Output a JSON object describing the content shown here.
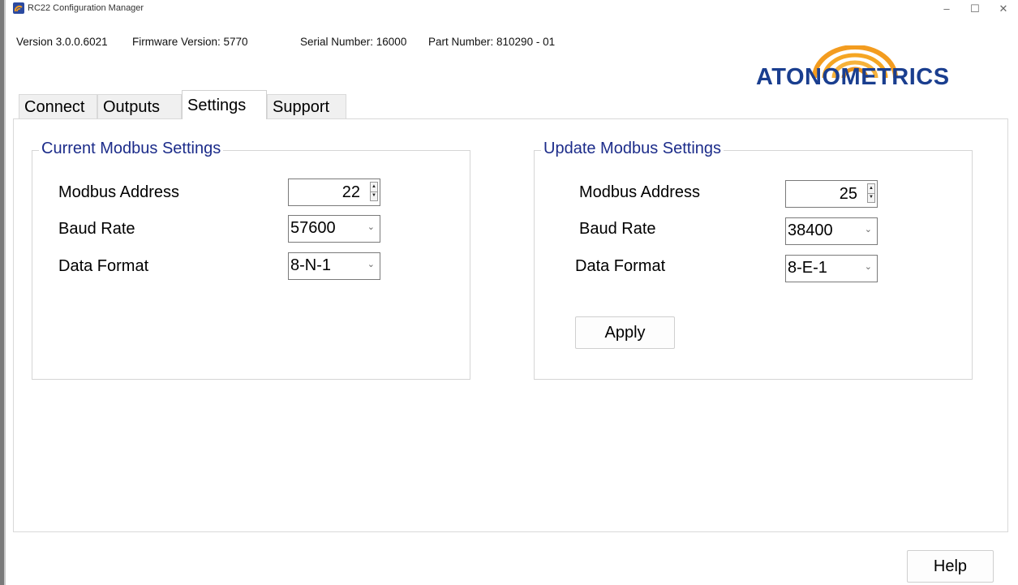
{
  "window": {
    "title": "RC22 Configuration Manager",
    "controls": {
      "minimize": "–",
      "maximize": "☐",
      "close": "✕"
    }
  },
  "info": {
    "version": "Version 3.0.0.6021",
    "firmware": "Firmware Version: 5770",
    "serial": "Serial Number: 16000",
    "part": "Part Number: 810290 - 01"
  },
  "logo": {
    "text": "ATONOMETRICS",
    "colors": {
      "arc": "#f39c1f",
      "text": "#1a3e8f"
    }
  },
  "tabs": [
    {
      "label": "Connect",
      "active": false
    },
    {
      "label": "Outputs",
      "active": false
    },
    {
      "label": "Settings",
      "active": true
    },
    {
      "label": "Support",
      "active": false
    }
  ],
  "current": {
    "title": "Current Modbus Settings",
    "address_label": "Modbus Address",
    "address_value": "22",
    "baud_label": "Baud Rate",
    "baud_value": "57600",
    "format_label": "Data Format",
    "format_value": "8-N-1"
  },
  "update": {
    "title": "Update Modbus Settings",
    "address_label": "Modbus Address",
    "address_value": "25",
    "baud_label": "Baud Rate",
    "baud_value": "38400",
    "format_label": "Data Format",
    "format_value": "8-E-1",
    "apply_label": "Apply"
  },
  "footer": {
    "help_label": "Help"
  },
  "colors": {
    "group_title": "#1c2c8a"
  }
}
